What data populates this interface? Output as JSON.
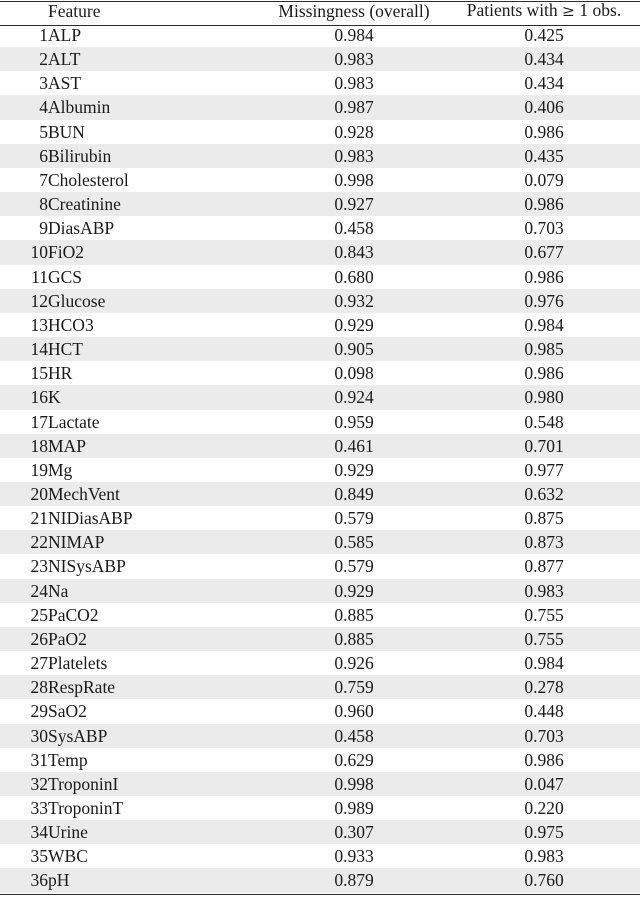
{
  "table": {
    "columns": {
      "index_header": "",
      "feature_header": "Feature",
      "missingness_header": "Missingness (overall)",
      "patients_header_prefix": "Patients with ",
      "patients_header_symbol": "≥",
      "patients_header_suffix": " 1 obs."
    },
    "style": {
      "shaded_row_color": "#ebebeb",
      "rule_color": "#2b2b2b",
      "background_color": "#ffffff",
      "text_color": "#1a1a1a"
    },
    "row_count": 36,
    "rows": [
      {
        "index": "1",
        "feature": "ALP",
        "missingness": "0.984",
        "patients": "0.425"
      },
      {
        "index": "2",
        "feature": "ALT",
        "missingness": "0.983",
        "patients": "0.434"
      },
      {
        "index": "3",
        "feature": "AST",
        "missingness": "0.983",
        "patients": "0.434"
      },
      {
        "index": "4",
        "feature": "Albumin",
        "missingness": "0.987",
        "patients": "0.406"
      },
      {
        "index": "5",
        "feature": "BUN",
        "missingness": "0.928",
        "patients": "0.986"
      },
      {
        "index": "6",
        "feature": "Bilirubin",
        "missingness": "0.983",
        "patients": "0.435"
      },
      {
        "index": "7",
        "feature": "Cholesterol",
        "missingness": "0.998",
        "patients": "0.079"
      },
      {
        "index": "8",
        "feature": "Creatinine",
        "missingness": "0.927",
        "patients": "0.986"
      },
      {
        "index": "9",
        "feature": "DiasABP",
        "missingness": "0.458",
        "patients": "0.703"
      },
      {
        "index": "10",
        "feature": "FiO2",
        "missingness": "0.843",
        "patients": "0.677"
      },
      {
        "index": "11",
        "feature": "GCS",
        "missingness": "0.680",
        "patients": "0.986"
      },
      {
        "index": "12",
        "feature": "Glucose",
        "missingness": "0.932",
        "patients": "0.976"
      },
      {
        "index": "13",
        "feature": "HCO3",
        "missingness": "0.929",
        "patients": "0.984"
      },
      {
        "index": "14",
        "feature": "HCT",
        "missingness": "0.905",
        "patients": "0.985"
      },
      {
        "index": "15",
        "feature": "HR",
        "missingness": "0.098",
        "patients": "0.986"
      },
      {
        "index": "16",
        "feature": "K",
        "missingness": "0.924",
        "patients": "0.980"
      },
      {
        "index": "17",
        "feature": "Lactate",
        "missingness": "0.959",
        "patients": "0.548"
      },
      {
        "index": "18",
        "feature": "MAP",
        "missingness": "0.461",
        "patients": "0.701"
      },
      {
        "index": "19",
        "feature": "Mg",
        "missingness": "0.929",
        "patients": "0.977"
      },
      {
        "index": "20",
        "feature": "MechVent",
        "missingness": "0.849",
        "patients": "0.632"
      },
      {
        "index": "21",
        "feature": "NIDiasABP",
        "missingness": "0.579",
        "patients": "0.875"
      },
      {
        "index": "22",
        "feature": "NIMAP",
        "missingness": "0.585",
        "patients": "0.873"
      },
      {
        "index": "23",
        "feature": "NISysABP",
        "missingness": "0.579",
        "patients": "0.877"
      },
      {
        "index": "24",
        "feature": "Na",
        "missingness": "0.929",
        "patients": "0.983"
      },
      {
        "index": "25",
        "feature": "PaCO2",
        "missingness": "0.885",
        "patients": "0.755"
      },
      {
        "index": "26",
        "feature": "PaO2",
        "missingness": "0.885",
        "patients": "0.755"
      },
      {
        "index": "27",
        "feature": "Platelets",
        "missingness": "0.926",
        "patients": "0.984"
      },
      {
        "index": "28",
        "feature": "RespRate",
        "missingness": "0.759",
        "patients": "0.278"
      },
      {
        "index": "29",
        "feature": "SaO2",
        "missingness": "0.960",
        "patients": "0.448"
      },
      {
        "index": "30",
        "feature": "SysABP",
        "missingness": "0.458",
        "patients": "0.703"
      },
      {
        "index": "31",
        "feature": "Temp",
        "missingness": "0.629",
        "patients": "0.986"
      },
      {
        "index": "32",
        "feature": "TroponinI",
        "missingness": "0.998",
        "patients": "0.047"
      },
      {
        "index": "33",
        "feature": "TroponinT",
        "missingness": "0.989",
        "patients": "0.220"
      },
      {
        "index": "34",
        "feature": "Urine",
        "missingness": "0.307",
        "patients": "0.975"
      },
      {
        "index": "35",
        "feature": "WBC",
        "missingness": "0.933",
        "patients": "0.983"
      },
      {
        "index": "36",
        "feature": "pH",
        "missingness": "0.879",
        "patients": "0.760"
      }
    ]
  }
}
